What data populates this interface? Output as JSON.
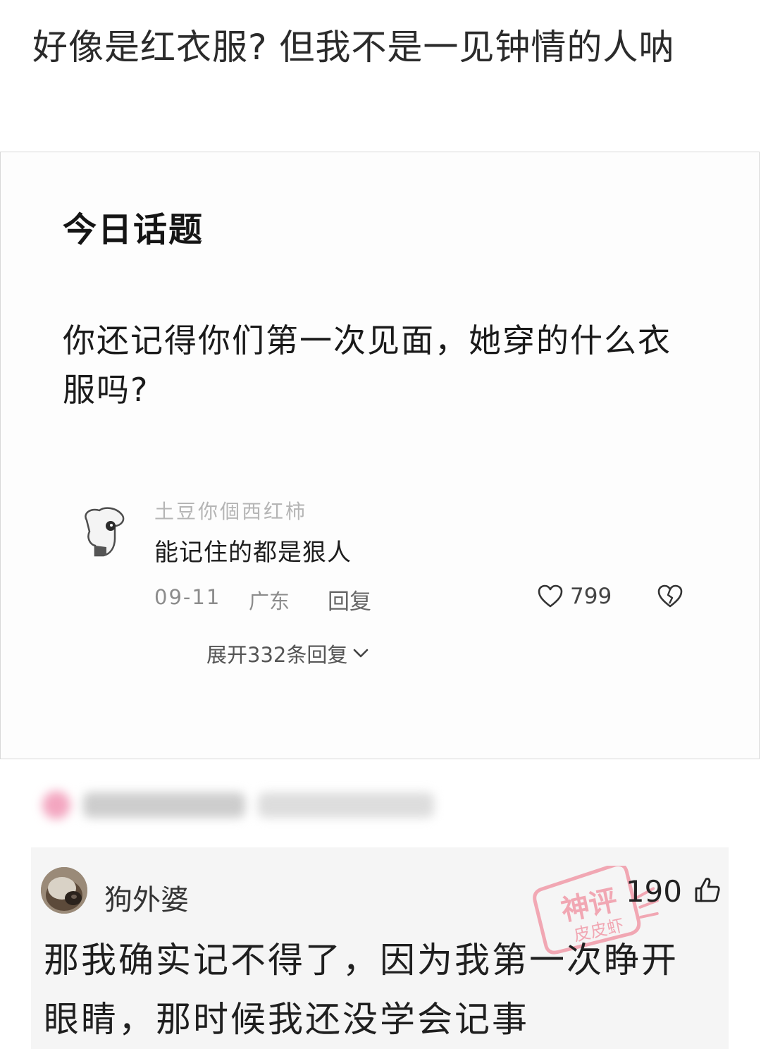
{
  "post": {
    "title": "好像是红衣服? 但我不是一见钟情的人呐"
  },
  "topic_card": {
    "heading": "今日话题",
    "question": "你还记得你们第一次见面，她穿的什么衣服吗?",
    "comment": {
      "username": "土豆你個西红柿",
      "text": "能记住的都是狠人",
      "date": "09-11",
      "region": "广东",
      "reply_label": "回复",
      "like_count": "799",
      "expand_label": "展开332条回复"
    }
  },
  "user_comment": {
    "username": "狗外婆",
    "likes": "190",
    "text": "那我确实记不得了，因为我第一次睁开眼睛，那时候我还没学会记事",
    "watermark_line1": "神评",
    "watermark_line2": "皮皮虾"
  },
  "icons": {
    "like": "heart-outline-icon",
    "dislike": "broken-heart-icon",
    "expand": "chevron-down-icon",
    "upvote": "thumbs-up-icon"
  },
  "colors": {
    "watermark": "#f19aa8",
    "card_border": "#d8d8d8",
    "comment_bg": "#f5f5f5"
  }
}
